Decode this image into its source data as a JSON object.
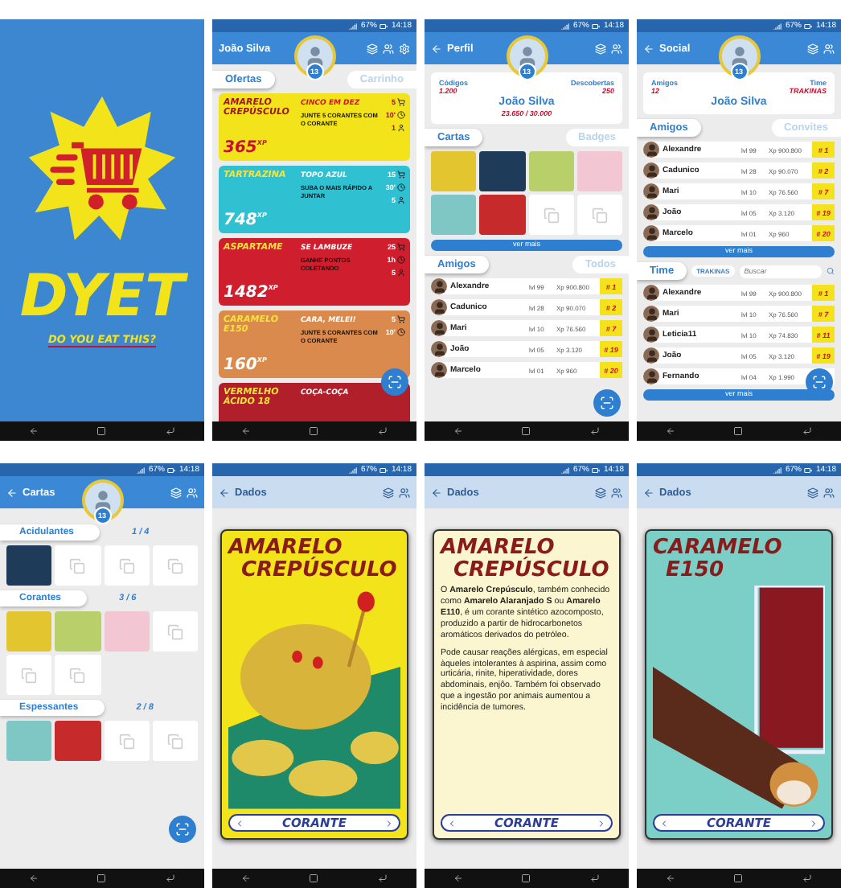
{
  "screens": [
    {
      "kind": "splash",
      "brand": "DYET",
      "tagline": "DO YOU EAT THIS?"
    },
    {
      "kind": "offers",
      "status": {
        "battery": "67%",
        "time": "14:18"
      },
      "title": "João Silva",
      "level": "13",
      "tabs": [
        {
          "label": "Ofertas",
          "selected": true
        },
        {
          "label": "Carrinho",
          "selected": false
        }
      ],
      "offers": [
        {
          "name": "AMARELO CREPÚSCULO",
          "price": "365",
          "unit": "XP",
          "title": "CINCO EM DEZ",
          "text": "JUNTE 5 CORANTES COM O CORANTE",
          "color": "#f2e31b",
          "stats": [
            {
              "kind": "cart",
              "value": "5"
            },
            {
              "kind": "time",
              "value": "10'"
            },
            {
              "kind": "people",
              "value": "1"
            }
          ]
        },
        {
          "name": "TARTRAZINA",
          "price": "748",
          "unit": "XP",
          "title": "TOPO AZUL",
          "text": "SUBA O MAIS RÁPIDO A JUNTAR",
          "color": "#2fc0d2",
          "stats": [
            {
              "kind": "cart",
              "value": "15"
            },
            {
              "kind": "time",
              "value": "30'"
            },
            {
              "kind": "people",
              "value": "5"
            }
          ]
        },
        {
          "name": "ASPARTAME",
          "price": "1482",
          "unit": "XP",
          "title": "SE LAMBUZE",
          "text": "GANHE PONTOS COLETANDO",
          "color": "#cf1f2e",
          "stats": [
            {
              "kind": "cart",
              "value": "25"
            },
            {
              "kind": "time",
              "value": "1h"
            },
            {
              "kind": "people",
              "value": "5"
            }
          ]
        },
        {
          "name": "CARAMELO E150",
          "price": "160",
          "unit": "XP",
          "title": "CARA, MELEI!",
          "text": "JUNTE 5 CORANTES COM O CORANTE",
          "color": "#d98a4c",
          "stats": [
            {
              "kind": "cart",
              "value": "5"
            },
            {
              "kind": "time",
              "value": "10'"
            }
          ]
        },
        {
          "name": "VERMELHO ÁCIDO 18",
          "title": "COÇA-COÇA",
          "color": "#b01f2a"
        }
      ]
    },
    {
      "kind": "profile",
      "status": {
        "battery": "67%",
        "time": "14:18"
      },
      "title": "Perfil",
      "level": "13",
      "stats": [
        {
          "label": "Códigos",
          "value": "1.200"
        },
        {
          "label": "Descobertas",
          "value": "250"
        }
      ],
      "name": "João Silva",
      "xp": "23.650 / 30.000",
      "card_tabs": [
        {
          "label": "Cartas",
          "selected": true
        },
        {
          "label": "Badges",
          "selected": false
        }
      ],
      "cards": [
        {
          "kind": "art",
          "color": "#e3c530"
        },
        {
          "kind": "art",
          "color": "#1f3b5a"
        },
        {
          "kind": "art",
          "color": "#b8cf6a"
        },
        {
          "kind": "art",
          "color": "#f3c6d3"
        },
        {
          "kind": "art",
          "color": "#7fc7c4"
        },
        {
          "kind": "art",
          "color": "#c62a2a"
        },
        {
          "kind": "empty"
        },
        {
          "kind": "empty"
        }
      ],
      "more": "ver mais",
      "friend_tabs": [
        {
          "label": "Amigos",
          "selected": true
        },
        {
          "label": "Todos",
          "selected": false
        }
      ],
      "friends": [
        {
          "name": "Alexandre",
          "level": "lvl 99",
          "xp": "Xp 900.800",
          "rank": "# 1"
        },
        {
          "name": "Cadunico",
          "level": "lvl 28",
          "xp": "Xp 90.070",
          "rank": "# 2"
        },
        {
          "name": "Mari",
          "level": "lvl 10",
          "xp": "Xp 76.560",
          "rank": "# 7"
        },
        {
          "name": "João",
          "level": "lvl 05",
          "xp": "Xp 3.120",
          "rank": "# 19"
        },
        {
          "name": "Marcelo",
          "level": "lvl 01",
          "xp": "Xp 960",
          "rank": "# 20"
        }
      ]
    },
    {
      "kind": "social",
      "status": {
        "battery": "67%",
        "time": "14:18"
      },
      "title": "Social",
      "level": "13",
      "stats": [
        {
          "label": "Amigos",
          "value": "12"
        },
        {
          "label": "Time",
          "value": "TRAKINAS"
        }
      ],
      "name": "João Silva",
      "friend_tabs": [
        {
          "label": "Amigos",
          "selected": true
        },
        {
          "label": "Convites",
          "selected": false
        }
      ],
      "friends": [
        {
          "name": "Alexandre",
          "level": "lvl 99",
          "xp": "Xp 900.800",
          "rank": "# 1"
        },
        {
          "name": "Cadunico",
          "level": "lvl 28",
          "xp": "Xp 90.070",
          "rank": "# 2"
        },
        {
          "name": "Mari",
          "level": "lvl 10",
          "xp": "Xp 76.560",
          "rank": "# 7"
        },
        {
          "name": "João",
          "level": "lvl 05",
          "xp": "Xp 3.120",
          "rank": "# 19"
        },
        {
          "name": "Marcelo",
          "level": "lvl 01",
          "xp": "Xp 960",
          "rank": "# 20"
        }
      ],
      "more": "ver mais",
      "team_tab": "Time",
      "team_chip": "TRAKINAS",
      "search": {
        "placeholder": "Buscar"
      },
      "team": [
        {
          "name": "Alexandre",
          "level": "lvl 99",
          "xp": "Xp 900.800",
          "rank": "# 1"
        },
        {
          "name": "Mari",
          "level": "lvl 10",
          "xp": "Xp 76.560",
          "rank": "# 7"
        },
        {
          "name": "Leticia11",
          "level": "lvl 10",
          "xp": "Xp 74.830",
          "rank": "# 11"
        },
        {
          "name": "João",
          "level": "lvl 05",
          "xp": "Xp 3.120",
          "rank": "# 19"
        },
        {
          "name": "Fernando",
          "level": "lvl 04",
          "xp": "Xp 1.990"
        }
      ],
      "team_more": "ver mais"
    },
    {
      "kind": "collection",
      "status": {
        "battery": "67%",
        "time": "14:18"
      },
      "title": "Cartas",
      "level": "13",
      "categories": [
        {
          "label": "Acidulantes",
          "count": "1 / 4",
          "cards": [
            {
              "kind": "art",
              "color": "#1f3b5a"
            },
            {
              "kind": "empty"
            },
            {
              "kind": "empty"
            },
            {
              "kind": "empty"
            }
          ]
        },
        {
          "label": "Corantes",
          "count": "3 / 6",
          "cards": [
            {
              "kind": "art",
              "color": "#e3c530"
            },
            {
              "kind": "art",
              "color": "#b8cf6a"
            },
            {
              "kind": "art",
              "color": "#f3c6d3"
            },
            {
              "kind": "empty"
            },
            {
              "kind": "empty"
            },
            {
              "kind": "empty"
            }
          ]
        },
        {
          "label": "Espessantes",
          "count": "2 / 8",
          "cards": [
            {
              "kind": "art",
              "color": "#7fc7c4"
            },
            {
              "kind": "art",
              "color": "#c62a2a"
            },
            {
              "kind": "empty"
            },
            {
              "kind": "empty"
            }
          ]
        }
      ]
    },
    {
      "kind": "card",
      "status": {
        "battery": "67%",
        "time": "14:18"
      },
      "title": "Dados",
      "card": {
        "kind": "blob",
        "color": "#f2e31b",
        "title_lines": [
          "AMARELO",
          "CREPÚSCULO"
        ],
        "category": "CORANTE"
      }
    },
    {
      "kind": "card",
      "status": {
        "battery": "67%",
        "time": "14:18"
      },
      "title": "Dados",
      "card": {
        "kind": "back",
        "color": "#fbf6cf",
        "title_lines": [
          "AMARELO",
          "CREPÚSCULO"
        ],
        "paragraphs": [
          "O **Amarelo Crepúsculo**, também conhecido como **Amarelo Alaranjado S** ou **Amarelo E110**, é um corante sintético azocomposto, produzido a partir de hidrocarbonetos aromáticos derivados do petróleo.",
          "Pode causar reações alérgicas, em especial àqueles intolerantes à aspirina, assim como urticária, rinite, hiperatividade, dores abdominais, enjôo. Também foi observado que a ingestão por animais aumentou a incidência de tumores."
        ],
        "category": "CORANTE"
      }
    },
    {
      "kind": "card",
      "status": {
        "battery": "67%",
        "time": "14:18"
      },
      "title": "Dados",
      "card": {
        "kind": "bar",
        "color": "#7ccfc6",
        "title_lines": [
          "CARAMELO",
          "E150"
        ],
        "category": "CORANTE"
      }
    }
  ]
}
